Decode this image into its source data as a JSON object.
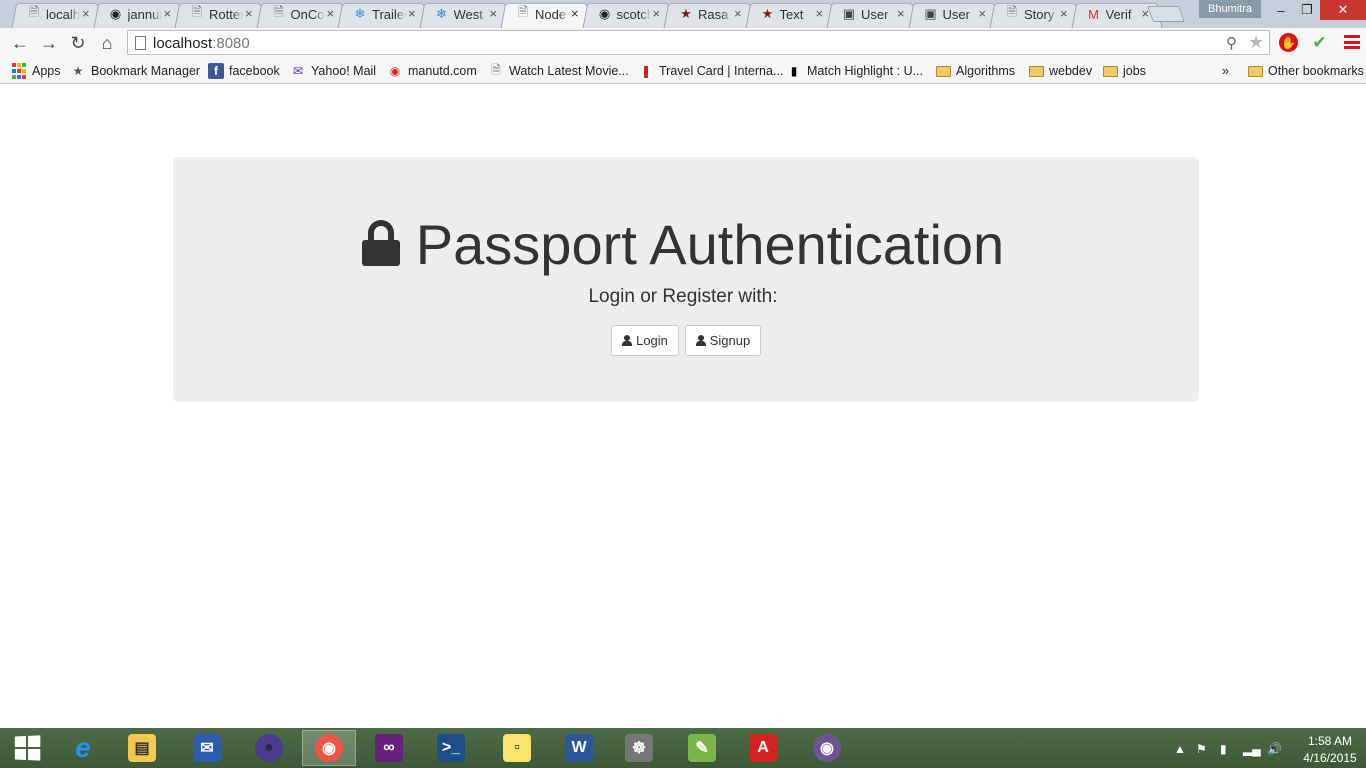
{
  "browser": {
    "tabs": [
      {
        "title": "localhost",
        "icon": "page-icon"
      },
      {
        "title": "jannunen",
        "icon": "github-icon"
      },
      {
        "title": "Rotten",
        "icon": "page-icon"
      },
      {
        "title": "OnCo",
        "icon": "page-icon"
      },
      {
        "title": "Trailer",
        "icon": "snowflake-icon"
      },
      {
        "title": "West",
        "icon": "snowflake-icon"
      },
      {
        "title": "Node",
        "icon": "page-icon",
        "active": true
      },
      {
        "title": "scotch",
        "icon": "github-icon"
      },
      {
        "title": "Rasa",
        "icon": "star-badge-icon"
      },
      {
        "title": "Text",
        "icon": "star-badge-icon"
      },
      {
        "title": "User",
        "icon": "stack-icon"
      },
      {
        "title": "User",
        "icon": "stack-icon"
      },
      {
        "title": "Story",
        "icon": "page-icon"
      },
      {
        "title": "Verif",
        "icon": "gmail-icon"
      }
    ],
    "tab_close_glyph": "×",
    "profile_name": "Bhumitra",
    "window_controls": {
      "minimize": "–",
      "restore": "❐",
      "close": "✕"
    },
    "url_host": "localhost",
    "url_port": ":8080",
    "bookmarks": [
      {
        "label": "Apps",
        "icon": "apps-grid-icon"
      },
      {
        "label": "Bookmark Manager",
        "icon": "star-icon"
      },
      {
        "label": "facebook",
        "icon": "facebook-icon"
      },
      {
        "label": "Yahoo! Mail",
        "icon": "mail-icon"
      },
      {
        "label": "manutd.com",
        "icon": "manutd-icon"
      },
      {
        "label": "Watch Latest Movie...",
        "icon": "page-icon"
      },
      {
        "label": "Travel Card | Interna...",
        "icon": "travel-icon"
      },
      {
        "label": "Match Highlight : U...",
        "icon": "match-icon"
      },
      {
        "label": "Algorithms",
        "icon": "folder-icon"
      },
      {
        "label": "webdev",
        "icon": "folder-icon"
      },
      {
        "label": "jobs",
        "icon": "folder-icon"
      }
    ],
    "bookmarks_overflow": "»",
    "other_bookmarks": "Other bookmarks"
  },
  "page": {
    "title": "Passport Authentication",
    "subtitle": "Login or Register with:",
    "login_label": "Login",
    "signup_label": "Signup"
  },
  "taskbar": {
    "apps": [
      "start-icon",
      "internet-explorer-icon",
      "file-explorer-icon",
      "thunderbird-icon",
      "eclipse-icon",
      "chrome-icon",
      "visual-studio-icon",
      "powershell-icon",
      "sticky-notes-icon",
      "word-icon",
      "network-icon",
      "notepadpp-icon",
      "acrobat-icon",
      "github-desktop-icon"
    ],
    "clock_time": "1:58 AM",
    "clock_date": "4/16/2015"
  },
  "colors": {
    "jumbotron_bg": "#eeeeee",
    "text": "#333333",
    "close_button": "#c7372f"
  }
}
